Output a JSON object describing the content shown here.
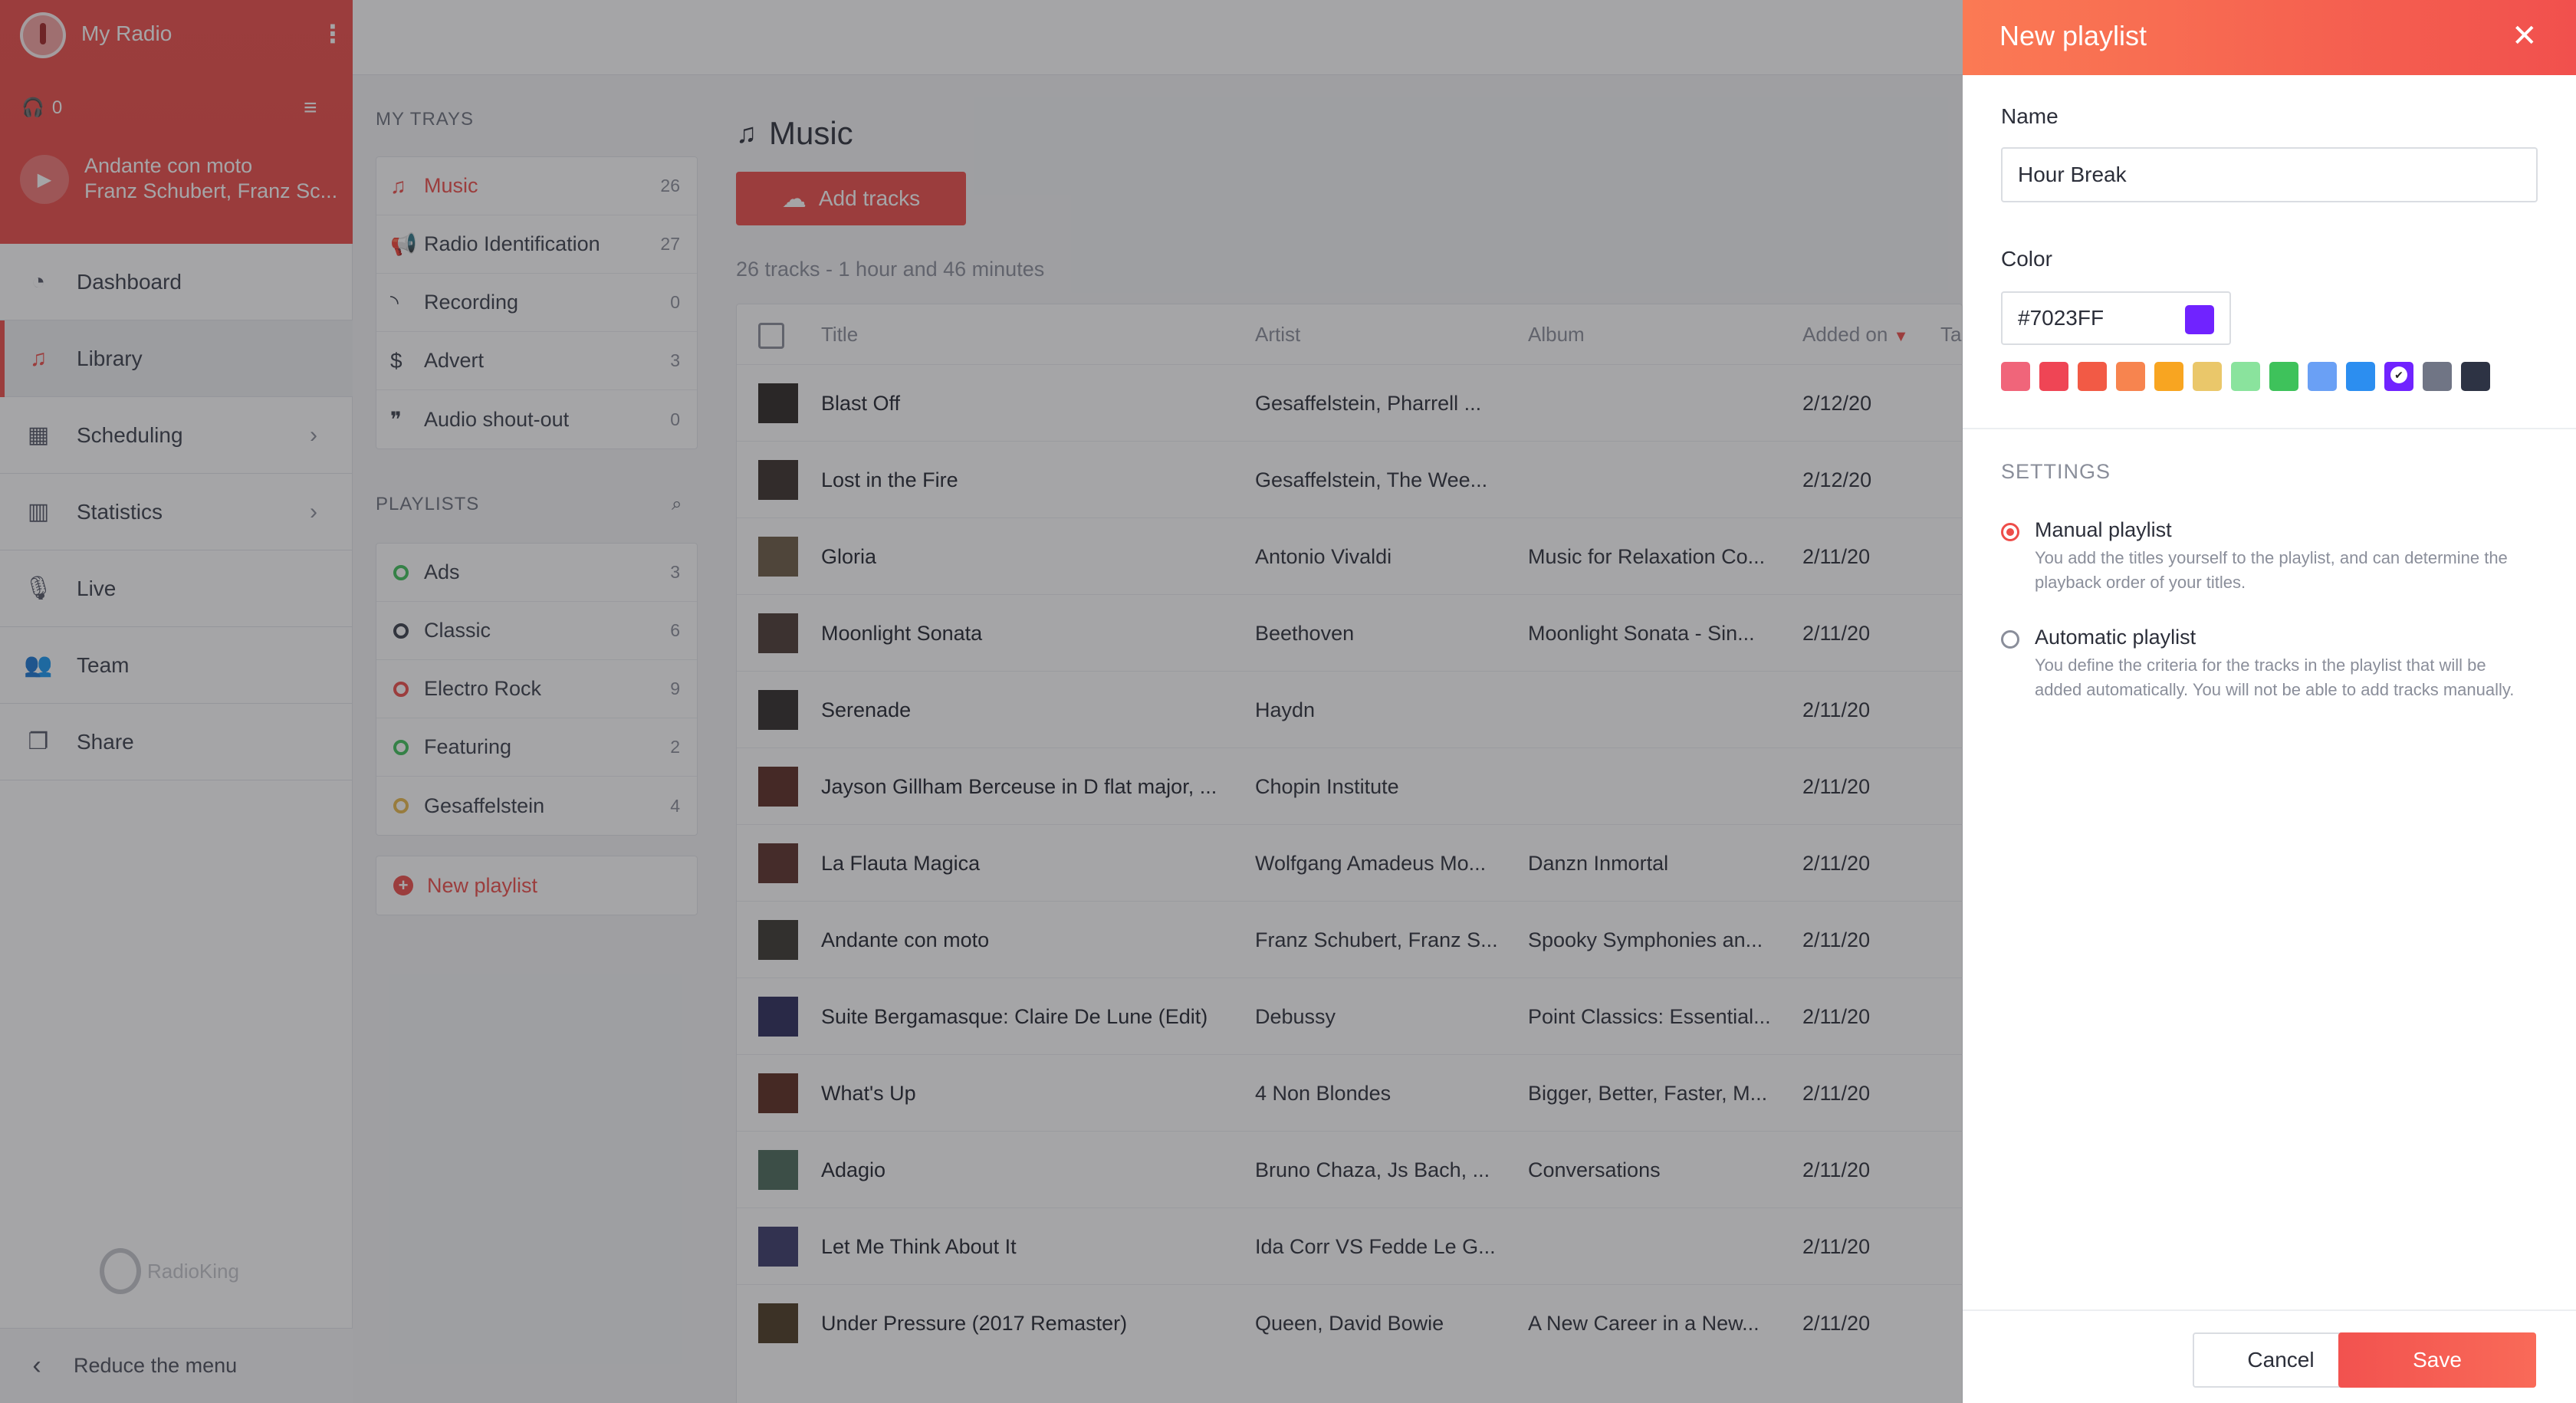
{
  "radio": {
    "name": "My Radio",
    "listeners": "0",
    "now_playing_title": "Andante con moto",
    "now_playing_artist": "Franz Schubert, Franz Sc..."
  },
  "nav": {
    "items": [
      {
        "label": "Dashboard",
        "icon": "gauge-icon"
      },
      {
        "label": "Library",
        "icon": "music-note-icon"
      },
      {
        "label": "Scheduling",
        "icon": "calendar-icon"
      },
      {
        "label": "Statistics",
        "icon": "bar-chart-icon"
      },
      {
        "label": "Live",
        "icon": "microphone-icon"
      },
      {
        "label": "Team",
        "icon": "users-icon"
      },
      {
        "label": "Share",
        "icon": "share-icon"
      }
    ],
    "brand": "RadioKing",
    "reduce_label": "Reduce the menu"
  },
  "trays": {
    "title": "MY TRAYS",
    "items": [
      {
        "label": "Music",
        "count": "26"
      },
      {
        "label": "Radio Identification",
        "count": "27"
      },
      {
        "label": "Recording",
        "count": "0"
      },
      {
        "label": "Advert",
        "count": "3"
      },
      {
        "label": "Audio shout-out",
        "count": "0"
      }
    ]
  },
  "playlists": {
    "title": "PLAYLISTS",
    "items": [
      {
        "label": "Ads",
        "count": "3",
        "color": "#3ec25b"
      },
      {
        "label": "Classic",
        "count": "6",
        "color": "#3a3e4a"
      },
      {
        "label": "Electro Rock",
        "count": "9",
        "color": "#ee4d49"
      },
      {
        "label": "Featuring",
        "count": "2",
        "color": "#3ec25b"
      },
      {
        "label": "Gesaffelstein",
        "count": "4",
        "color": "#e8b84a"
      }
    ],
    "new_label": "New playlist"
  },
  "main": {
    "title": "Music",
    "add_tracks_label": "Add tracks",
    "summary": "26 tracks - 1 hour and 46 minutes",
    "columns": {
      "title": "Title",
      "artist": "Artist",
      "album": "Album",
      "added_on": "Added on",
      "extra": "Ta"
    },
    "rows": [
      {
        "title": "Blast Off",
        "artist": "Gesaffelstein, Pharrell ...",
        "album": "",
        "added": "2/12/20"
      },
      {
        "title": "Lost in the Fire",
        "artist": "Gesaffelstein, The Wee...",
        "album": "",
        "added": "2/12/20"
      },
      {
        "title": "Gloria",
        "artist": "Antonio Vivaldi",
        "album": "Music for Relaxation Co...",
        "added": "2/11/20"
      },
      {
        "title": "Moonlight Sonata",
        "artist": "Beethoven",
        "album": "Moonlight Sonata - Sin...",
        "added": "2/11/20"
      },
      {
        "title": "Serenade",
        "artist": "Haydn",
        "album": "",
        "added": "2/11/20"
      },
      {
        "title": "Jayson Gillham Berceuse in D flat major, ...",
        "artist": "Chopin Institute",
        "album": "",
        "added": "2/11/20"
      },
      {
        "title": "La Flauta Magica",
        "artist": "Wolfgang Amadeus Mo...",
        "album": "Danzn Inmortal",
        "added": "2/11/20"
      },
      {
        "title": "Andante con moto",
        "artist": "Franz Schubert, Franz S...",
        "album": "Spooky Symphonies an...",
        "added": "2/11/20"
      },
      {
        "title": "Suite Bergamasque: Claire De Lune (Edit)",
        "artist": "Debussy",
        "album": "Point Classics: Essential...",
        "added": "2/11/20"
      },
      {
        "title": "What's Up",
        "artist": "4 Non Blondes",
        "album": "Bigger, Better, Faster, M...",
        "added": "2/11/20"
      },
      {
        "title": "Adagio",
        "artist": "Bruno Chaza, Js Bach, ...",
        "album": "Conversations",
        "added": "2/11/20"
      },
      {
        "title": "Let Me Think About It",
        "artist": "Ida Corr VS Fedde Le G...",
        "album": "",
        "added": "2/11/20"
      },
      {
        "title": "Under Pressure (2017 Remaster)",
        "artist": "Queen, David Bowie",
        "album": "A New Career in a New...",
        "added": "2/11/20"
      }
    ]
  },
  "drawer": {
    "title": "New playlist",
    "name_label": "Name",
    "name_value": "Hour Break",
    "color_label": "Color",
    "color_value": "#7023FF",
    "swatches": [
      "#f0657a",
      "#ef4555",
      "#f25a45",
      "#f7844f",
      "#f8a521",
      "#eac76a",
      "#8ae39d",
      "#3ec25b",
      "#6aa0f5",
      "#2c8ef0",
      "#7023FF",
      "#707585",
      "#2d3344"
    ],
    "selected_swatch": 10,
    "settings_title": "SETTINGS",
    "manual_title": "Manual playlist",
    "manual_desc": "You add the titles yourself to the playlist, and can determine the playback order of your titles.",
    "auto_title": "Automatic playlist",
    "auto_desc": "You define the criteria for the tracks in the playlist that will be added automatically. You will not be able to add tracks manually.",
    "cancel_label": "Cancel",
    "save_label": "Save"
  }
}
